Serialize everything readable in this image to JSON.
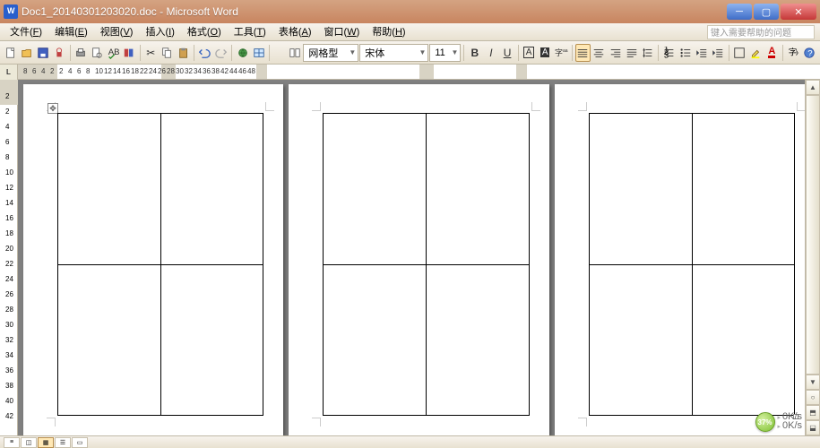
{
  "titlebar": {
    "title": "Doc1_20140301203020.doc - Microsoft Word"
  },
  "menubar": {
    "items": [
      {
        "label": "文件",
        "key": "F"
      },
      {
        "label": "编辑",
        "key": "E"
      },
      {
        "label": "视图",
        "key": "V"
      },
      {
        "label": "插入",
        "key": "I"
      },
      {
        "label": "格式",
        "key": "O"
      },
      {
        "label": "工具",
        "key": "T"
      },
      {
        "label": "表格",
        "key": "A"
      },
      {
        "label": "窗口",
        "key": "W"
      },
      {
        "label": "帮助",
        "key": "H"
      }
    ],
    "help_placeholder": "键入需要帮助的问题"
  },
  "format_toolbar": {
    "style": "网格型",
    "font": "宋体",
    "size": "11"
  },
  "ruler": {
    "h_numbers": [
      "8",
      "6",
      "4",
      "2",
      "2",
      "4",
      "6",
      "8",
      "10",
      "12",
      "14",
      "16",
      "18",
      "22",
      "24",
      "26",
      "28",
      "30",
      "32",
      "34",
      "36",
      "38",
      "42",
      "44",
      "46",
      "48"
    ],
    "v_numbers": [
      "2",
      "2",
      "4",
      "6",
      "8",
      "10",
      "12",
      "14",
      "16",
      "18",
      "20",
      "22",
      "24",
      "26",
      "28",
      "30",
      "32",
      "34",
      "36",
      "38",
      "40",
      "42"
    ]
  },
  "status": {
    "percent": "37%",
    "rate_up": "0K/s",
    "rate_down": "0K/s"
  },
  "icons": {
    "new": "new-doc-icon",
    "open": "open-icon",
    "save": "save-icon",
    "perm": "permission-icon",
    "print": "print-icon",
    "preview": "preview-icon",
    "spell": "spell-icon",
    "research": "research-icon",
    "cut": "cut-icon",
    "copy": "copy-icon",
    "paste": "paste-icon",
    "undo": "undo-icon",
    "redo": "redo-icon",
    "link": "hyperlink-icon",
    "tables": "tables-borders-icon",
    "read": "read-icon",
    "bold": "bold-icon",
    "italic": "italic-icon",
    "underline": "underline-icon",
    "char_border": "char-border-icon",
    "char_shade": "char-shading-icon",
    "phonetic": "phonetic-icon",
    "align_l": "align-left-icon",
    "align_c": "align-center-icon",
    "align_r": "align-right-icon",
    "align_j": "align-justify-icon",
    "linesp": "line-spacing-icon",
    "numlist": "number-list-icon",
    "bullist": "bullet-list-icon",
    "outdent": "outdent-icon",
    "indent": "indent-icon",
    "borders": "borders-icon",
    "highlight": "highlight-icon",
    "fontcolor": "font-color-icon",
    "strike": "char-scale-icon",
    "help": "toolbar-help-icon"
  }
}
